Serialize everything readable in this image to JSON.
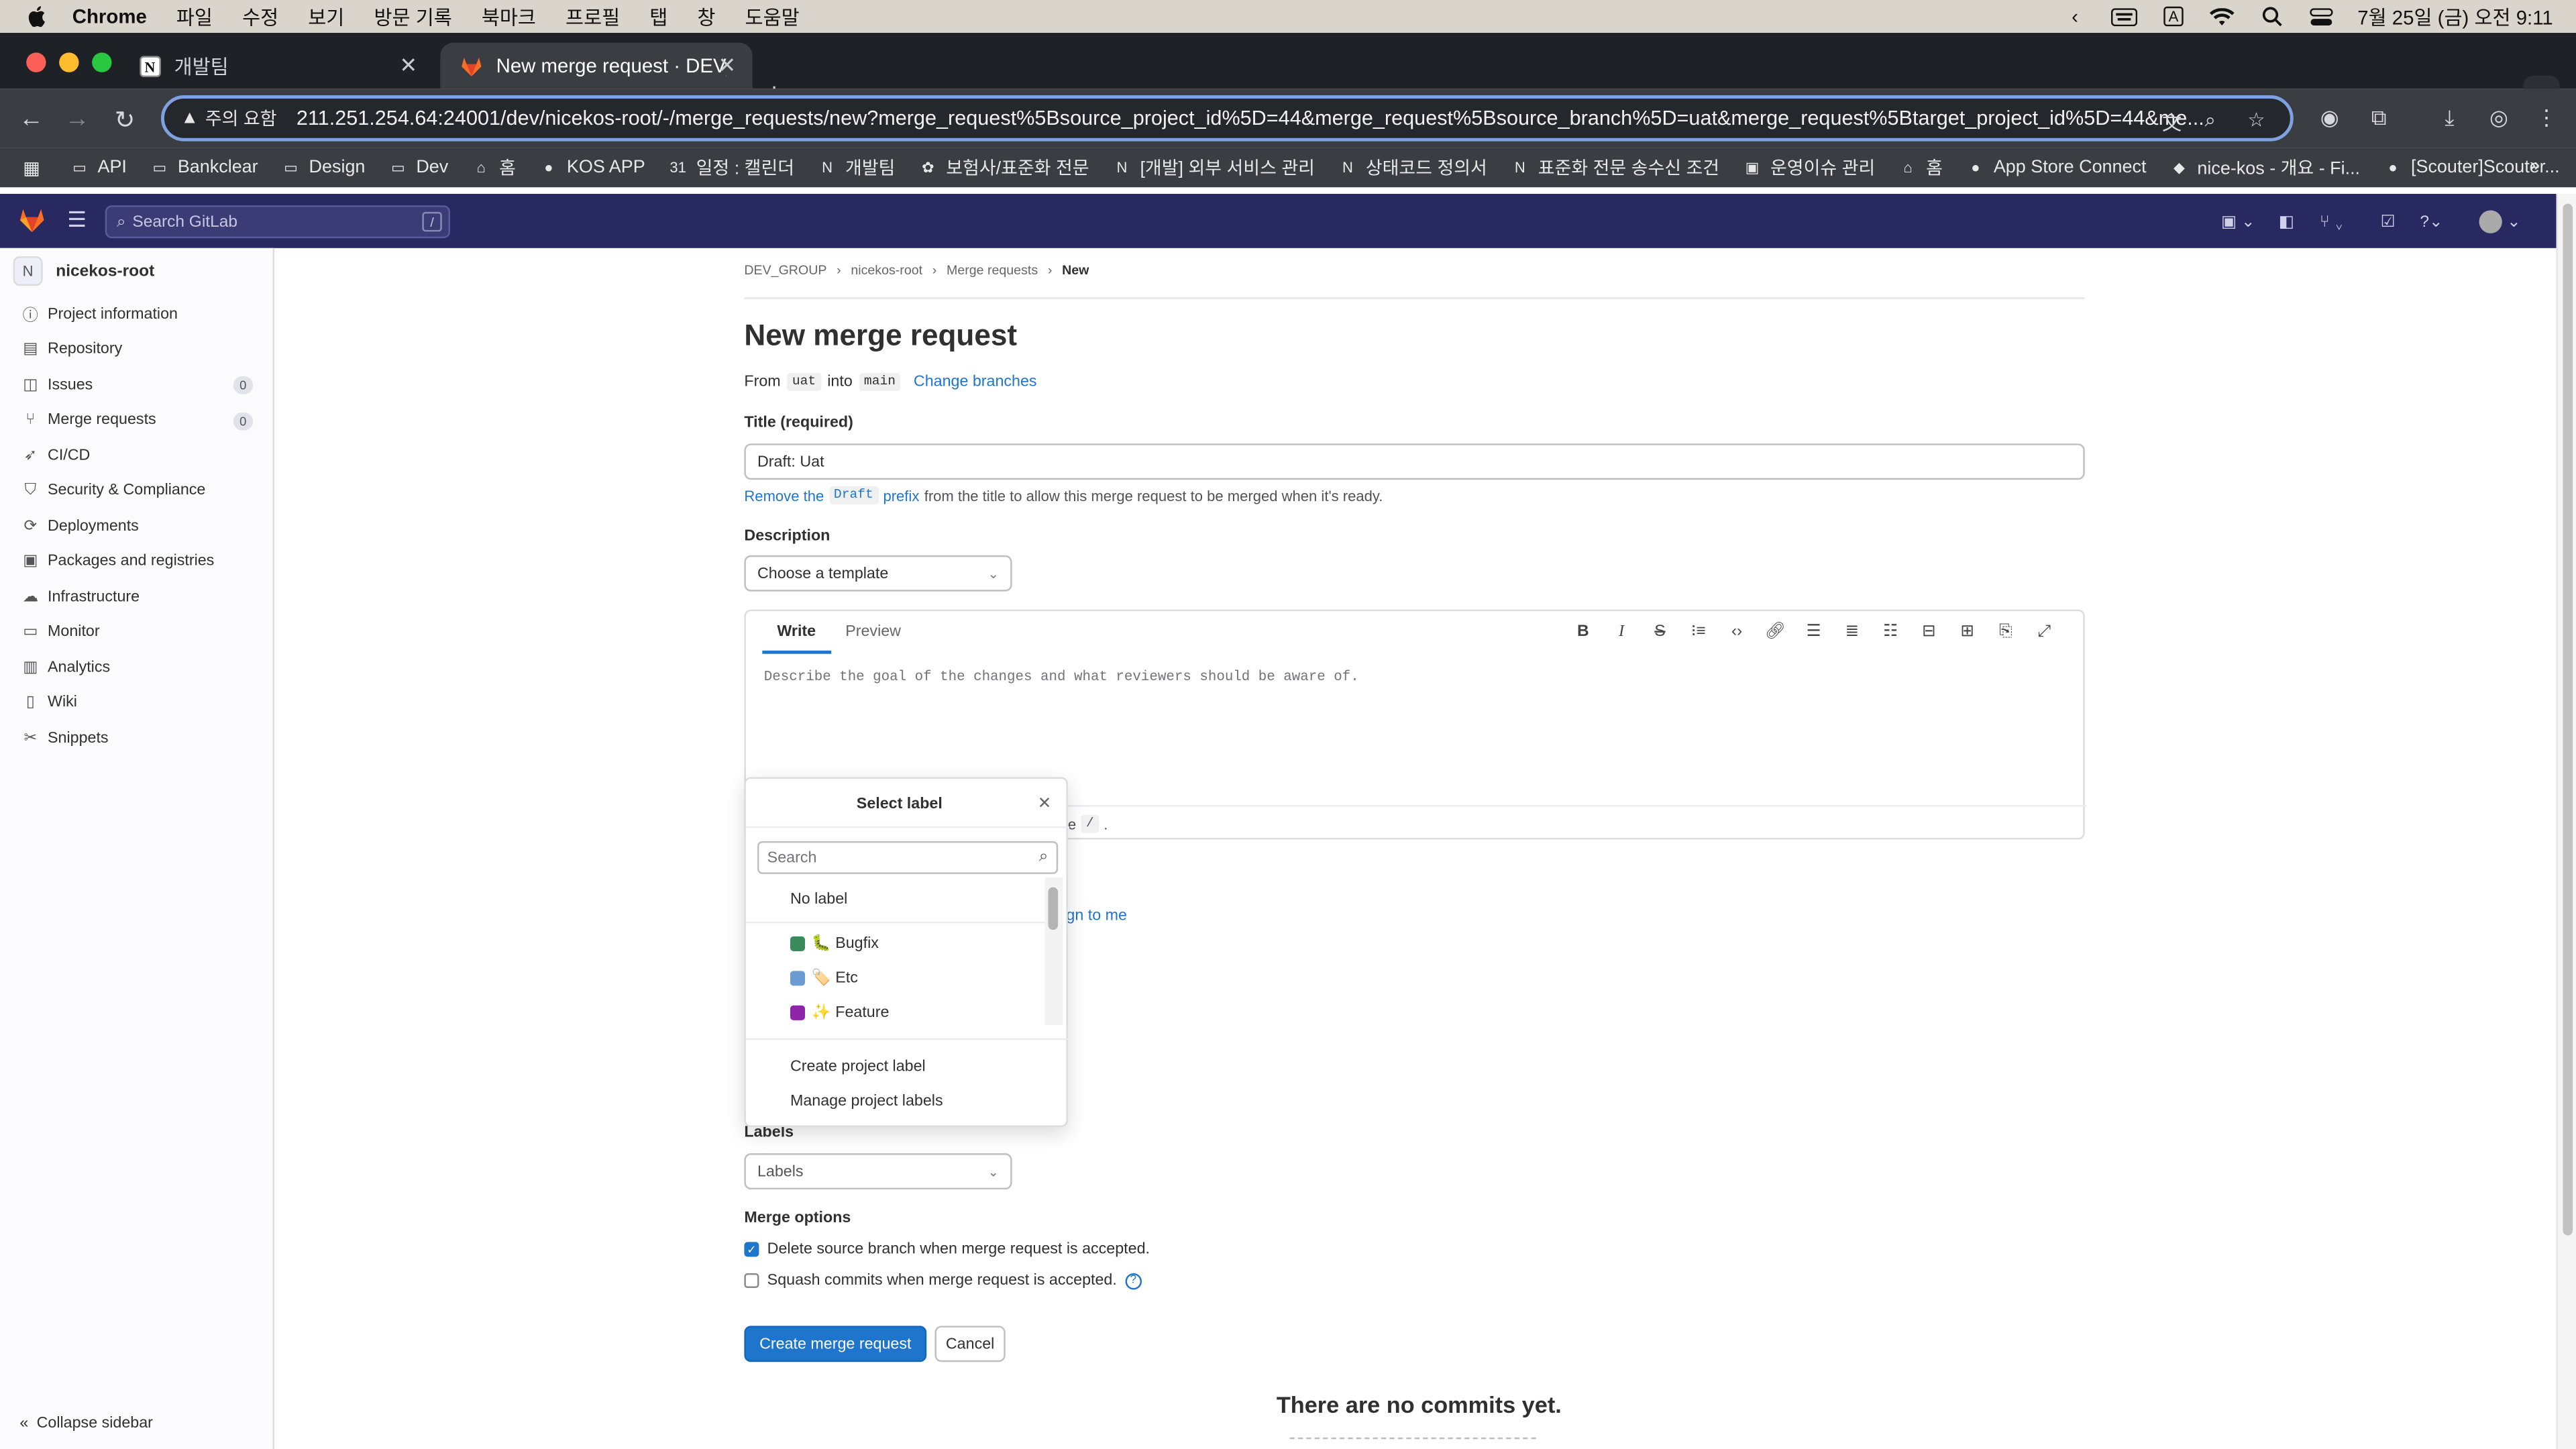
{
  "macos": {
    "app_name": "Chrome",
    "menus": [
      "파일",
      "수정",
      "보기",
      "방문 기록",
      "북마크",
      "프로필",
      "탭",
      "창",
      "도움말"
    ],
    "clock": "7월 25일 (금) 오전 9:11",
    "input_indicator": "A"
  },
  "browser": {
    "tabs": [
      {
        "title": "개발팀",
        "active": false
      },
      {
        "title": "New merge request · DEV_GR",
        "active": true
      }
    ],
    "security_label": "주의 요함",
    "url": "211.251.254.64:24001/dev/nicekos-root/-/merge_requests/new?merge_request%5Bsource_project_id%5D=44&merge_request%5Bsource_branch%5D=uat&merge_request%5Btarget_project_id%5D=44&me...",
    "bookmarks": [
      "API",
      "Bankclear",
      "Design",
      "Dev",
      "홈",
      "KOS APP",
      "일정 : 캘린더",
      "개발팀",
      "보험사/표준화 전문",
      "[개발] 외부 서비스 관리",
      "상태코드 정의서",
      "표준화 전문 송수신 조건",
      "운영이슈 관리",
      "홈",
      "App Store Connect",
      "nice-kos - 개요 - Fi...",
      "[Scouter]Scouter..."
    ]
  },
  "gitlab": {
    "search_placeholder": "Search GitLab",
    "search_shortcut": "/",
    "project_avatar": "N",
    "project_name": "nicekos-root",
    "sidebar": [
      {
        "label": "Project information",
        "icon": "info-icon"
      },
      {
        "label": "Repository",
        "icon": "doc-icon"
      },
      {
        "label": "Issues",
        "icon": "issues-icon",
        "count": "0"
      },
      {
        "label": "Merge requests",
        "icon": "merge-icon",
        "count": "0"
      },
      {
        "label": "CI/CD",
        "icon": "rocket-icon"
      },
      {
        "label": "Security & Compliance",
        "icon": "shield-icon"
      },
      {
        "label": "Deployments",
        "icon": "deploy-icon"
      },
      {
        "label": "Packages and registries",
        "icon": "package-icon"
      },
      {
        "label": "Infrastructure",
        "icon": "cloud-icon"
      },
      {
        "label": "Monitor",
        "icon": "monitor-icon"
      },
      {
        "label": "Analytics",
        "icon": "chart-icon"
      },
      {
        "label": "Wiki",
        "icon": "book-icon"
      },
      {
        "label": "Snippets",
        "icon": "snippet-icon"
      }
    ],
    "collapse_label": "Collapse sidebar"
  },
  "page": {
    "breadcrumb": [
      "DEV_GROUP",
      "nicekos-root",
      "Merge requests",
      "New"
    ],
    "title": "New merge request",
    "from_label": "From",
    "source_branch": "uat",
    "into_label": "into",
    "target_branch": "main",
    "change_branches": "Change branches",
    "title_label": "Title (required)",
    "title_value": "Draft: Uat",
    "draft_hint_link": "Remove the",
    "draft_hint_code": "Draft",
    "draft_hint_link2": "prefix",
    "draft_hint_rest": "from the title to allow this merge request to be merged when it's ready.",
    "description_label": "Description",
    "template_select": "Choose a template",
    "write_tab": "Write",
    "preview_tab": "Preview",
    "description_placeholder": "Describe the goal of the changes and what reviewers should be aware of.",
    "editor_hint_tail": "e",
    "editor_hint_code": "/",
    "editor_hint_end": ".",
    "assign_to_me": "gn to me",
    "labels_label": "Labels",
    "labels_select": "Labels",
    "merge_options_label": "Merge options",
    "delete_branch": "Delete source branch when merge request is accepted.",
    "delete_branch_checked": true,
    "squash_commits": "Squash commits when merge request is accepted.",
    "squash_checked": false,
    "create_button": "Create merge request",
    "cancel_button": "Cancel",
    "no_commits": "There are no commits yet."
  },
  "label_dropdown": {
    "title": "Select label",
    "search_placeholder": "Search",
    "no_label": "No label",
    "labels": [
      {
        "name": "🐛 Bugfix",
        "color": "#3a8a5c"
      },
      {
        "name": "🏷️ Etc",
        "color": "#6b9bd1"
      },
      {
        "name": "✨ Feature",
        "color": "#8e24aa"
      }
    ],
    "create_label": "Create project label",
    "manage_labels": "Manage project labels"
  },
  "colors": {
    "gitlab_nav": "#292961",
    "primary": "#1f75cb"
  }
}
